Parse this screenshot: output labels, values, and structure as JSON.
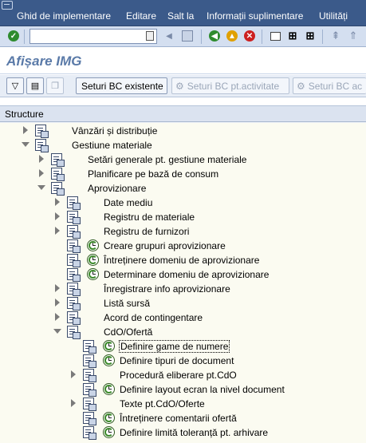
{
  "menubar": {
    "items": [
      "Ghid de implementare",
      "Editare",
      "Salt la",
      "Informații suplimentare",
      "Utilități"
    ]
  },
  "toolbar": {
    "command_field_value": "",
    "icons": [
      "enter-icon",
      "back-icon",
      "exit-icon",
      "cancel-icon",
      "print-icon",
      "find-icon",
      "find-next-icon",
      "first-page-icon"
    ]
  },
  "title": {
    "text": "Afișare IMG"
  },
  "app_toolbar": {
    "buttons": [
      {
        "label": "Seturi BC existente",
        "enabled": true
      },
      {
        "label": "Seturi BC pt.activitate",
        "enabled": false
      },
      {
        "label": "Seturi BC ac",
        "enabled": false
      }
    ]
  },
  "tree": {
    "header": "Structure",
    "nodes": [
      {
        "label": "Vânzări și distribuție",
        "level": 0,
        "state": "collapsed",
        "activity": false
      },
      {
        "label": "Gestiune materiale",
        "level": 0,
        "state": "expanded",
        "activity": false
      },
      {
        "label": "Setări generale pt. gestiune materiale",
        "level": 1,
        "state": "collapsed",
        "activity": false
      },
      {
        "label": "Planificare pe bază de consum",
        "level": 1,
        "state": "collapsed",
        "activity": false
      },
      {
        "label": "Aprovizionare",
        "level": 1,
        "state": "expanded",
        "activity": false
      },
      {
        "label": "Date mediu",
        "level": 2,
        "state": "collapsed",
        "activity": false
      },
      {
        "label": "Registru de materiale",
        "level": 2,
        "state": "collapsed",
        "activity": false
      },
      {
        "label": "Registru de furnizori",
        "level": 2,
        "state": "collapsed",
        "activity": false
      },
      {
        "label": "Creare grupuri aprovizionare",
        "level": 2,
        "state": "leaf",
        "activity": true
      },
      {
        "label": "Întreținere domeniu de aprovizionare",
        "level": 2,
        "state": "leaf",
        "activity": true
      },
      {
        "label": "Determinare domeniu de aprovizionare",
        "level": 2,
        "state": "leaf",
        "activity": true
      },
      {
        "label": "Înregistrare info aprovizionare",
        "level": 2,
        "state": "collapsed",
        "activity": false
      },
      {
        "label": "Listă sursă",
        "level": 2,
        "state": "collapsed",
        "activity": false
      },
      {
        "label": "Acord de contingentare",
        "level": 2,
        "state": "collapsed",
        "activity": false
      },
      {
        "label": "CdO/Ofertă",
        "level": 2,
        "state": "expanded",
        "activity": false
      },
      {
        "label": "Definire game de numere",
        "level": 3,
        "state": "leaf",
        "activity": true,
        "focused": true
      },
      {
        "label": "Definire tipuri de document",
        "level": 3,
        "state": "leaf",
        "activity": true
      },
      {
        "label": "Procedură eliberare pt.CdO",
        "level": 3,
        "state": "collapsed",
        "activity": false
      },
      {
        "label": "Definire layout ecran la nivel document",
        "level": 3,
        "state": "leaf",
        "activity": true
      },
      {
        "label": "Texte pt.CdO/Oferte",
        "level": 3,
        "state": "collapsed",
        "activity": false
      },
      {
        "label": "Întreținere comentarii ofertă",
        "level": 3,
        "state": "leaf",
        "activity": true
      },
      {
        "label": "Definire limită toleranță pt. arhivare",
        "level": 3,
        "state": "leaf",
        "activity": true
      }
    ]
  }
}
